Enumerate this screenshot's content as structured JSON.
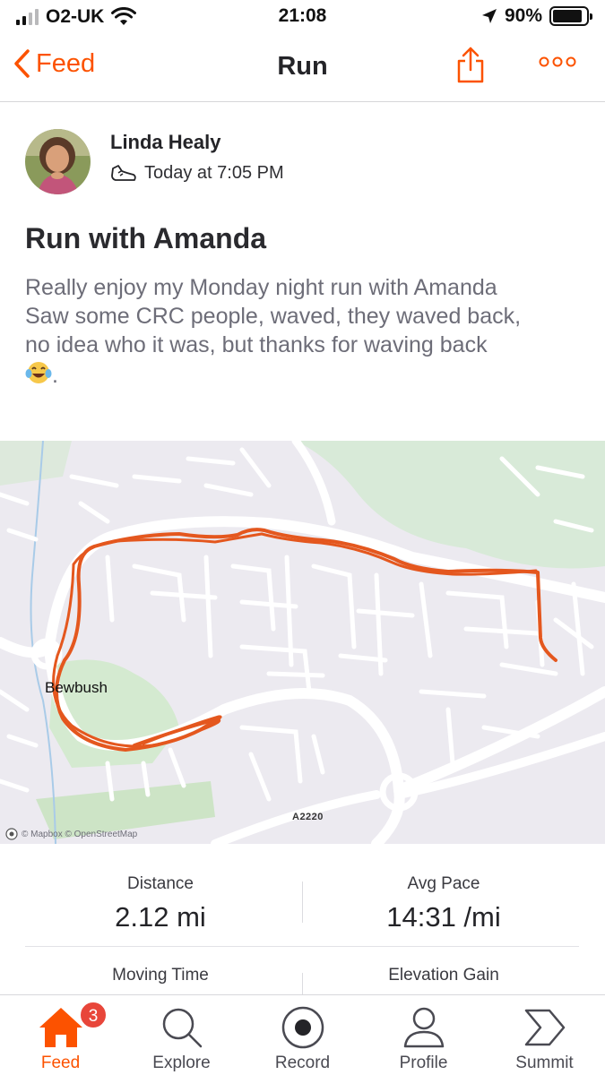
{
  "status_bar": {
    "carrier": "O2-UK",
    "time": "21:08",
    "battery_percent": "90%",
    "battery_level": 0.9,
    "icons": [
      "signal-icon",
      "wifi-icon",
      "location-arrow-icon",
      "battery-icon"
    ]
  },
  "nav": {
    "back_label": "Feed",
    "title": "Run",
    "share_icon": "share-icon",
    "more_icon": "more-dots-icon"
  },
  "activity": {
    "athlete_name": "Linda Healy",
    "activity_icon": "shoe-icon",
    "timestamp": "Today at 7:05 PM",
    "title": "Run with Amanda",
    "description_lines": [
      "Really enjoy my Monday night run with Amanda",
      "Saw some CRC people, waved, they waved back,",
      "no idea who it was, but thanks for waving back"
    ],
    "description_end": "."
  },
  "map": {
    "place_label": "Bewbush",
    "road_label": "A2220",
    "attribution": "© Mapbox © OpenStreetMap",
    "route_color": "#e4571e"
  },
  "stats": {
    "distance_label": "Distance",
    "distance_value": "2.12 mi",
    "pace_label": "Avg Pace",
    "pace_value": "14:31 /mi",
    "moving_time_label": "Moving Time",
    "elevation_label": "Elevation Gain"
  },
  "tab_bar": {
    "tabs": [
      {
        "label": "Feed",
        "icon": "home-icon",
        "active": true,
        "badge": "3"
      },
      {
        "label": "Explore",
        "icon": "search-icon"
      },
      {
        "label": "Record",
        "icon": "record-icon"
      },
      {
        "label": "Profile",
        "icon": "profile-icon"
      },
      {
        "label": "Summit",
        "icon": "summit-icon"
      }
    ]
  },
  "colors": {
    "accent": "#fc5200",
    "badge": "#e8463a",
    "text": "#242428",
    "muted": "#6d6d78"
  }
}
